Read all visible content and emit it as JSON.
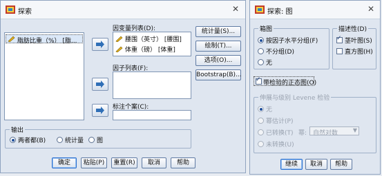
{
  "explore": {
    "title": "探索",
    "source_list": [
      "脂肪比重（%） [脂..."
    ],
    "dependent": {
      "label": "因变量列表(D):",
      "items": [
        "腰围（英寸） [腰围]",
        "体重（磅） [体重]"
      ]
    },
    "factor": {
      "label": "因子列表(F):"
    },
    "case_label": {
      "label": "标注个案(C):"
    },
    "side_buttons": [
      "统计量(S)...",
      "绘制(T)...",
      "选项(O)...",
      "Bootstrap(B)..."
    ],
    "output": {
      "label": "输出",
      "options": [
        "两者都(B)",
        "统计量",
        "图"
      ],
      "selected": 0
    },
    "buttons": [
      "确定",
      "粘贴(P)",
      "重置(R)",
      "取消",
      "帮助"
    ]
  },
  "plots": {
    "title": "探索: 图",
    "boxplot": {
      "label": "箱图",
      "options": [
        "按因子水平分组(F)",
        "不分组(D)",
        "无"
      ],
      "selected": 0
    },
    "descriptive": {
      "label": "描述性(D)",
      "options": [
        {
          "text": "茎叶图(S)",
          "checked": true
        },
        {
          "text": "直方图(H)",
          "checked": false
        }
      ]
    },
    "normality": {
      "text": "带检验的正态图(O)",
      "checked": true
    },
    "levene": {
      "label": "伸展与级别 Levene 检验",
      "options": [
        "无",
        "幂估计(P)",
        "已转换(T)",
        "未转换(U)"
      ],
      "selected": 0,
      "power_label": "幂:",
      "power_value": "自然对数"
    },
    "buttons": [
      "继续",
      "取消",
      "帮助"
    ]
  }
}
